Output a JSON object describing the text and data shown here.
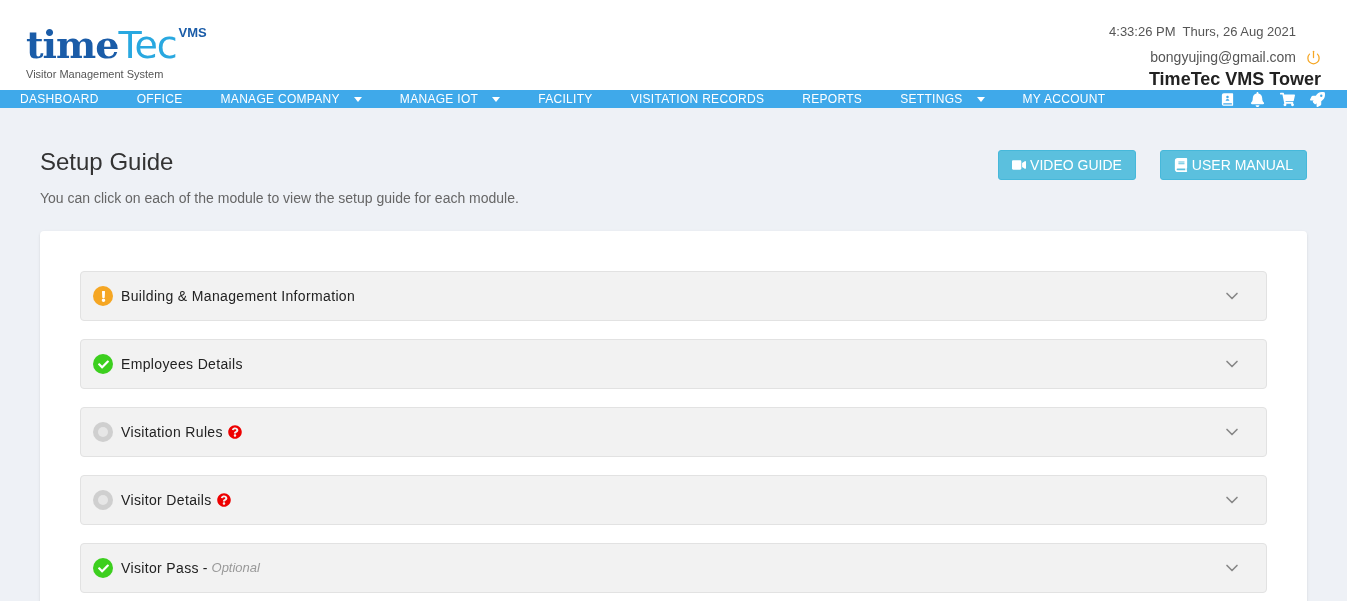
{
  "logo": {
    "word_a": "time",
    "word_b": "Tec",
    "badge": "VMS",
    "tagline": "Visitor Management System"
  },
  "header": {
    "datetime": "4:33:26 PM  Thurs, 26 Aug 2021",
    "email": "bongyujing@gmail.com",
    "site": "TimeTec VMS Tower"
  },
  "nav": [
    {
      "label": "DASHBOARD",
      "dropdown": false
    },
    {
      "label": "OFFICE",
      "dropdown": false
    },
    {
      "label": "MANAGE COMPANY",
      "dropdown": true
    },
    {
      "label": "MANAGE IOT",
      "dropdown": true
    },
    {
      "label": "FACILITY",
      "dropdown": false
    },
    {
      "label": "VISITATION RECORDS",
      "dropdown": false
    },
    {
      "label": "REPORTS",
      "dropdown": false
    },
    {
      "label": "SETTINGS",
      "dropdown": true
    },
    {
      "label": "MY ACCOUNT",
      "dropdown": false
    }
  ],
  "page": {
    "title": "Setup Guide",
    "subtitle": "You can click on each of the module to view the setup guide for each module.",
    "buttons": [
      {
        "kind": "video",
        "label": "VIDEO GUIDE"
      },
      {
        "kind": "manual",
        "label": "USER MANUAL"
      }
    ]
  },
  "modules": [
    {
      "title": "Building & Management Information",
      "kind": "warning",
      "help": false,
      "expanded": false
    },
    {
      "title": "Employees Details",
      "kind": "done",
      "help": false,
      "expanded": false
    },
    {
      "title": "Visitation Rules",
      "kind": "pending",
      "help": true,
      "expanded": false
    },
    {
      "title": "Visitor Details",
      "kind": "pending",
      "help": true,
      "expanded": false
    },
    {
      "title": "Visitor Pass",
      "kind": "done",
      "help": false,
      "expanded": false,
      "separator": "-",
      "note": "Optional"
    }
  ]
}
